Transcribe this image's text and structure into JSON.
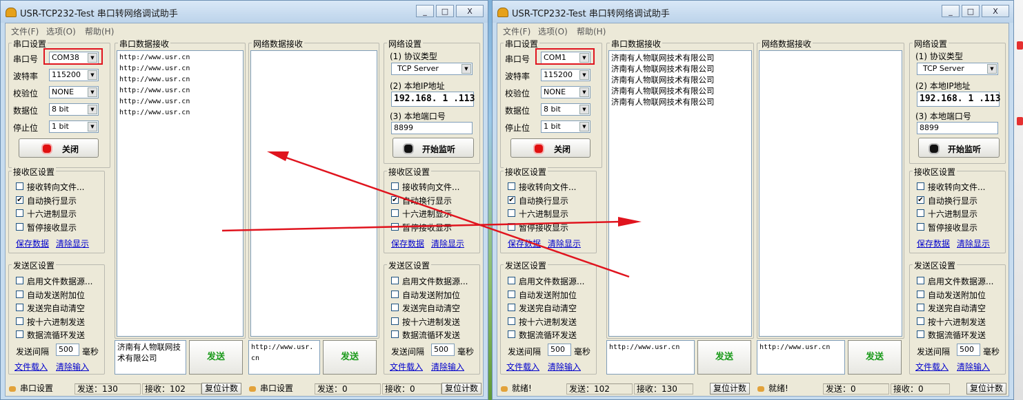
{
  "windows": [
    {
      "title": "USR-TCP232-Test 串口转网络调试助手",
      "titlebar_buttons": [
        "_",
        "□",
        "X"
      ],
      "menu": [
        "文件(F)",
        "选项(O)",
        "帮助(H)"
      ],
      "serial_settings": {
        "title": "串口设置",
        "port_label": "串口号",
        "port_value": "COM38",
        "baud_label": "波特率",
        "baud_value": "115200",
        "parity_label": "校验位",
        "parity_value": "NONE",
        "databits_label": "数据位",
        "databits_value": "8 bit",
        "stopbits_label": "停止位",
        "stopbits_value": "1 bit",
        "button_label": "关闭"
      },
      "serial_recv_settings": {
        "title": "接收区设置",
        "options": [
          {
            "label": "接收转向文件...",
            "checked": false
          },
          {
            "label": "自动换行显示",
            "checked": true
          },
          {
            "label": "十六进制显示",
            "checked": false
          },
          {
            "label": "暂停接收显示",
            "checked": false
          }
        ],
        "save_link": "保存数据",
        "clear_link": "清除显示"
      },
      "serial_send_settings": {
        "title": "发送区设置",
        "options": [
          {
            "label": "启用文件数据源...",
            "checked": false
          },
          {
            "label": "自动发送附加位",
            "checked": false
          },
          {
            "label": "发送完自动清空",
            "checked": false
          },
          {
            "label": "按十六进制发送",
            "checked": false
          },
          {
            "label": "数据流循环发送",
            "checked": false
          }
        ],
        "interval_label": "发送间隔",
        "interval_value": "500",
        "interval_unit": "毫秒",
        "load_link": "文件载入",
        "clear_link": "清除输入"
      },
      "serial_recv": {
        "title": "串口数据接收",
        "lines": [
          "http://www.usr.cn",
          "http://www.usr.cn",
          "http://www.usr.cn",
          "http://www.usr.cn",
          "http://www.usr.cn",
          "http://www.usr.cn"
        ]
      },
      "serial_send_text": "济南有人物联网技术有限公司",
      "serial_send_button": "发送",
      "net_recv": {
        "title": "网络数据接收",
        "lines": []
      },
      "net_send_text": "http://www.usr.cn",
      "net_send_button": "发送",
      "net_settings": {
        "title": "网络设置",
        "protocol_label": "(1) 协议类型",
        "protocol_value": "TCP Server",
        "ip_label": "(2) 本地IP地址",
        "ip_value": "192.168. 1 .113",
        "port_label": "(3) 本地端口号",
        "port_value": "8899",
        "listen_button": "开始监听"
      },
      "net_recv_settings": {
        "title": "接收区设置",
        "options": [
          {
            "label": "接收转向文件...",
            "checked": false
          },
          {
            "label": "自动换行显示",
            "checked": true
          },
          {
            "label": "十六进制显示",
            "checked": false
          },
          {
            "label": "暂停接收显示",
            "checked": false
          }
        ],
        "save_link": "保存数据",
        "clear_link": "清除显示"
      },
      "net_send_settings": {
        "title": "发送区设置",
        "options": [
          {
            "label": "启用文件数据源...",
            "checked": false
          },
          {
            "label": "自动发送附加位",
            "checked": false
          },
          {
            "label": "发送完自动清空",
            "checked": false
          },
          {
            "label": "按十六进制发送",
            "checked": false
          },
          {
            "label": "数据流循环发送",
            "checked": false
          }
        ],
        "interval_label": "发送间隔",
        "interval_value": "500",
        "interval_unit": "毫秒",
        "load_link": "文件载入",
        "clear_link": "清除输入"
      },
      "status": {
        "left_status": "串口设置",
        "left_sent": "发送：130",
        "left_recv": "接收：102",
        "left_reset": "复位计数",
        "right_status": "串口设置",
        "right_sent": "发送：0",
        "right_recv": "接收：0",
        "right_reset": "复位计数"
      }
    },
    {
      "title": "USR-TCP232-Test 串口转网络调试助手",
      "titlebar_buttons": [
        "_",
        "□",
        "X"
      ],
      "menu": [
        "文件(F)",
        "选项(O)",
        "帮助(H)"
      ],
      "serial_settings": {
        "title": "串口设置",
        "port_label": "串口号",
        "port_value": "COM1",
        "baud_label": "波特率",
        "baud_value": "115200",
        "parity_label": "校验位",
        "parity_value": "NONE",
        "databits_label": "数据位",
        "databits_value": "8 bit",
        "stopbits_label": "停止位",
        "stopbits_value": "1 bit",
        "button_label": "关闭"
      },
      "serial_recv_settings": {
        "title": "接收区设置",
        "options": [
          {
            "label": "接收转向文件...",
            "checked": false
          },
          {
            "label": "自动换行显示",
            "checked": true
          },
          {
            "label": "十六进制显示",
            "checked": false
          },
          {
            "label": "暂停接收显示",
            "checked": false
          }
        ],
        "save_link": "保存数据",
        "clear_link": "清除显示"
      },
      "serial_send_settings": {
        "title": "发送区设置",
        "options": [
          {
            "label": "启用文件数据源...",
            "checked": false
          },
          {
            "label": "自动发送附加位",
            "checked": false
          },
          {
            "label": "发送完自动清空",
            "checked": false
          },
          {
            "label": "按十六进制发送",
            "checked": false
          },
          {
            "label": "数据流循环发送",
            "checked": false
          }
        ],
        "interval_label": "发送间隔",
        "interval_value": "500",
        "interval_unit": "毫秒",
        "load_link": "文件载入",
        "clear_link": "清除输入"
      },
      "serial_recv": {
        "title": "串口数据接收",
        "lines": [
          "济南有人物联网技术有限公司",
          "济南有人物联网技术有限公司",
          "济南有人物联网技术有限公司",
          "济南有人物联网技术有限公司",
          "济南有人物联网技术有限公司"
        ]
      },
      "serial_send_text": "http://www.usr.cn",
      "serial_send_button": "发送",
      "net_recv": {
        "title": "网络数据接收",
        "lines": []
      },
      "net_send_text": "http://www.usr.cn",
      "net_send_button": "发送",
      "net_settings": {
        "title": "网络设置",
        "protocol_label": "(1) 协议类型",
        "protocol_value": "TCP Server",
        "ip_label": "(2) 本地IP地址",
        "ip_value": "192.168. 1 .113",
        "port_label": "(3) 本地端口号",
        "port_value": "8899",
        "listen_button": "开始监听"
      },
      "net_recv_settings": {
        "title": "接收区设置",
        "options": [
          {
            "label": "接收转向文件...",
            "checked": false
          },
          {
            "label": "自动换行显示",
            "checked": true
          },
          {
            "label": "十六进制显示",
            "checked": false
          },
          {
            "label": "暂停接收显示",
            "checked": false
          }
        ],
        "save_link": "保存数据",
        "clear_link": "清除显示"
      },
      "net_send_settings": {
        "title": "发送区设置",
        "options": [
          {
            "label": "启用文件数据源...",
            "checked": false
          },
          {
            "label": "自动发送附加位",
            "checked": false
          },
          {
            "label": "发送完自动清空",
            "checked": false
          },
          {
            "label": "按十六进制发送",
            "checked": false
          },
          {
            "label": "数据流循环发送",
            "checked": false
          }
        ],
        "interval_label": "发送间隔",
        "interval_value": "500",
        "interval_unit": "毫秒",
        "load_link": "文件载入",
        "clear_link": "清除输入"
      },
      "status": {
        "left_status": "就绪!",
        "left_sent": "发送：102",
        "left_recv": "接收：130",
        "left_reset": "复位计数",
        "right_status": "就绪!",
        "right_sent": "发送：0",
        "right_recv": "接收：0",
        "right_reset": "复位计数"
      }
    }
  ],
  "colors": {
    "annotation_red": "#e0141e",
    "send_green": "#1a9a1a",
    "link_blue": "#0000cc"
  }
}
